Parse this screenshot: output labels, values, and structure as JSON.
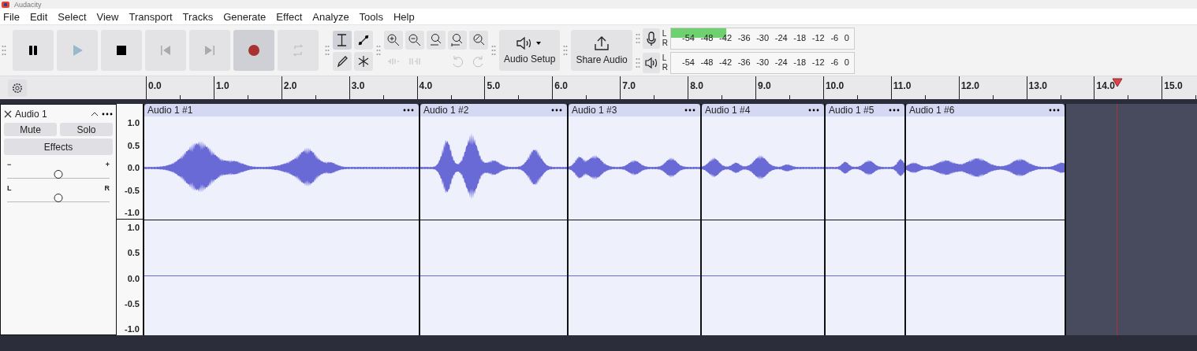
{
  "window": {
    "title": "Audacity"
  },
  "menu": [
    "File",
    "Edit",
    "Select",
    "View",
    "Transport",
    "Tracks",
    "Generate",
    "Effect",
    "Analyze",
    "Tools",
    "Help"
  ],
  "transport": [
    {
      "kind": "pause"
    },
    {
      "kind": "play"
    },
    {
      "kind": "stop"
    },
    {
      "kind": "start"
    },
    {
      "kind": "end"
    },
    {
      "kind": "record"
    },
    {
      "kind": "loop"
    }
  ],
  "tools": [
    {
      "kind": "select",
      "selected": true
    },
    {
      "kind": "envelope",
      "selected": false
    },
    {
      "kind": "draw",
      "selected": false
    },
    {
      "kind": "multi",
      "selected": false
    }
  ],
  "edit_tools": [
    {
      "kind": "zoom-in",
      "disabled": false
    },
    {
      "kind": "zoom-out",
      "disabled": false
    },
    {
      "kind": "fit-selection",
      "disabled": false
    },
    {
      "kind": "fit-project",
      "disabled": false
    },
    {
      "kind": "zoom-toggle",
      "disabled": false
    },
    {
      "kind": "trim",
      "disabled": true
    },
    {
      "kind": "silence",
      "disabled": true
    },
    {
      "kind": "undo",
      "disabled": true
    },
    {
      "kind": "redo",
      "disabled": true
    }
  ],
  "audio_setup": {
    "label": "Audio Setup"
  },
  "share_audio": {
    "label": "Share Audio"
  },
  "meters": [
    {
      "kind": "record",
      "channels": [
        {
          "label": "L",
          "level": 0.3
        },
        {
          "label": "R"
        }
      ],
      "ticks": [
        "-54",
        "-48",
        "-42",
        "-36",
        "-30",
        "-24",
        "-18",
        "-12",
        "-6",
        "0"
      ]
    },
    {
      "kind": "playback",
      "channels": [
        {
          "label": "L"
        },
        {
          "label": "R"
        }
      ],
      "ticks": [
        "-54",
        "-48",
        "-42",
        "-36",
        "-30",
        "-24",
        "-18",
        "-12",
        "-6",
        "0"
      ]
    }
  ],
  "ruler": [
    "0.0",
    "1.0",
    "2.0",
    "3.0",
    "4.0",
    "5.0",
    "6.0",
    "7.0",
    "8.0",
    "9.0",
    "10.0",
    "11.0",
    "12.0",
    "13.0",
    "14.0",
    "15.0"
  ],
  "track": {
    "name": "Audio 1",
    "mute": "Mute",
    "solo": "Solo",
    "effects": "Effects",
    "gain": {
      "min": "−",
      "max": "+",
      "level": 0.5
    },
    "pan": {
      "min": "L",
      "max": "R",
      "level": 0.5
    },
    "channels": [
      {
        "axis": [
          "1.0",
          "0.5",
          "0.0",
          "-0.5",
          "-1.0"
        ]
      },
      {
        "axis": [
          "1.0",
          "0.5",
          "0.0",
          "-0.5",
          "-1.0"
        ]
      }
    ],
    "clips": [
      "Audio 1 #1",
      "Audio 1 #2",
      "Audio 1 #3",
      "Audio 1 #4",
      "Audio 1 #5",
      "Audio 1 #6"
    ]
  }
}
